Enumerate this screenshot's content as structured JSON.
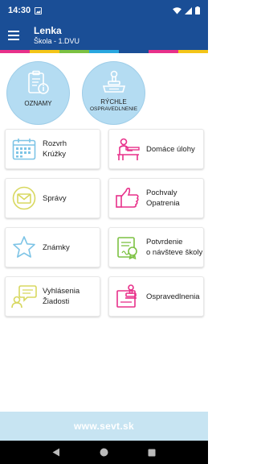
{
  "status": {
    "time": "14:30"
  },
  "header": {
    "name": "Lenka",
    "subtitle": "Škola - 1.DVU"
  },
  "stripe_colors": [
    "#e8308a",
    "#f4c518",
    "#7cc142",
    "#29a7df",
    "#1a4e96",
    "#e8308a",
    "#f4c518"
  ],
  "circles": {
    "oznamy": {
      "label": "OZNAMY",
      "icon": "clipboard-info-icon"
    },
    "rychle": {
      "label1": "RÝCHLE",
      "label2": "OSPRAVEDLNENIE",
      "icon": "stamp-icon"
    }
  },
  "tiles": [
    {
      "key": "rozvrh",
      "line1": "Rozvrh",
      "line2": "Krúžky",
      "icon": "calendar-icon",
      "color": "#7dc4e6"
    },
    {
      "key": "domace",
      "line1": "Domáce úlohy",
      "line2": "",
      "icon": "student-desk-icon",
      "color": "#e8308a"
    },
    {
      "key": "spravy",
      "line1": "Správy",
      "line2": "",
      "icon": "envelope-icon",
      "color": "#d8d860"
    },
    {
      "key": "pochvaly",
      "line1": "Pochvaly",
      "line2": "Opatrenia",
      "icon": "thumbs-up-icon",
      "color": "#e8308a"
    },
    {
      "key": "znamky",
      "line1": "Známky",
      "line2": "",
      "icon": "star-icon",
      "color": "#7dc4e6"
    },
    {
      "key": "potvrdenie",
      "line1": "Potvrdenie",
      "line2": "o návšteve školy",
      "icon": "certificate-icon",
      "color": "#7cc142"
    },
    {
      "key": "vyhlasenia",
      "line1": "Vyhlásenia",
      "line2": "Žiadosti",
      "icon": "speech-person-icon",
      "color": "#d8d860"
    },
    {
      "key": "ospravedlnenia",
      "line1": "Ospravedlnenia",
      "line2": "",
      "icon": "stamp-paper-icon",
      "color": "#e8308a"
    }
  ],
  "footer": {
    "text": "www.sevt.sk"
  }
}
